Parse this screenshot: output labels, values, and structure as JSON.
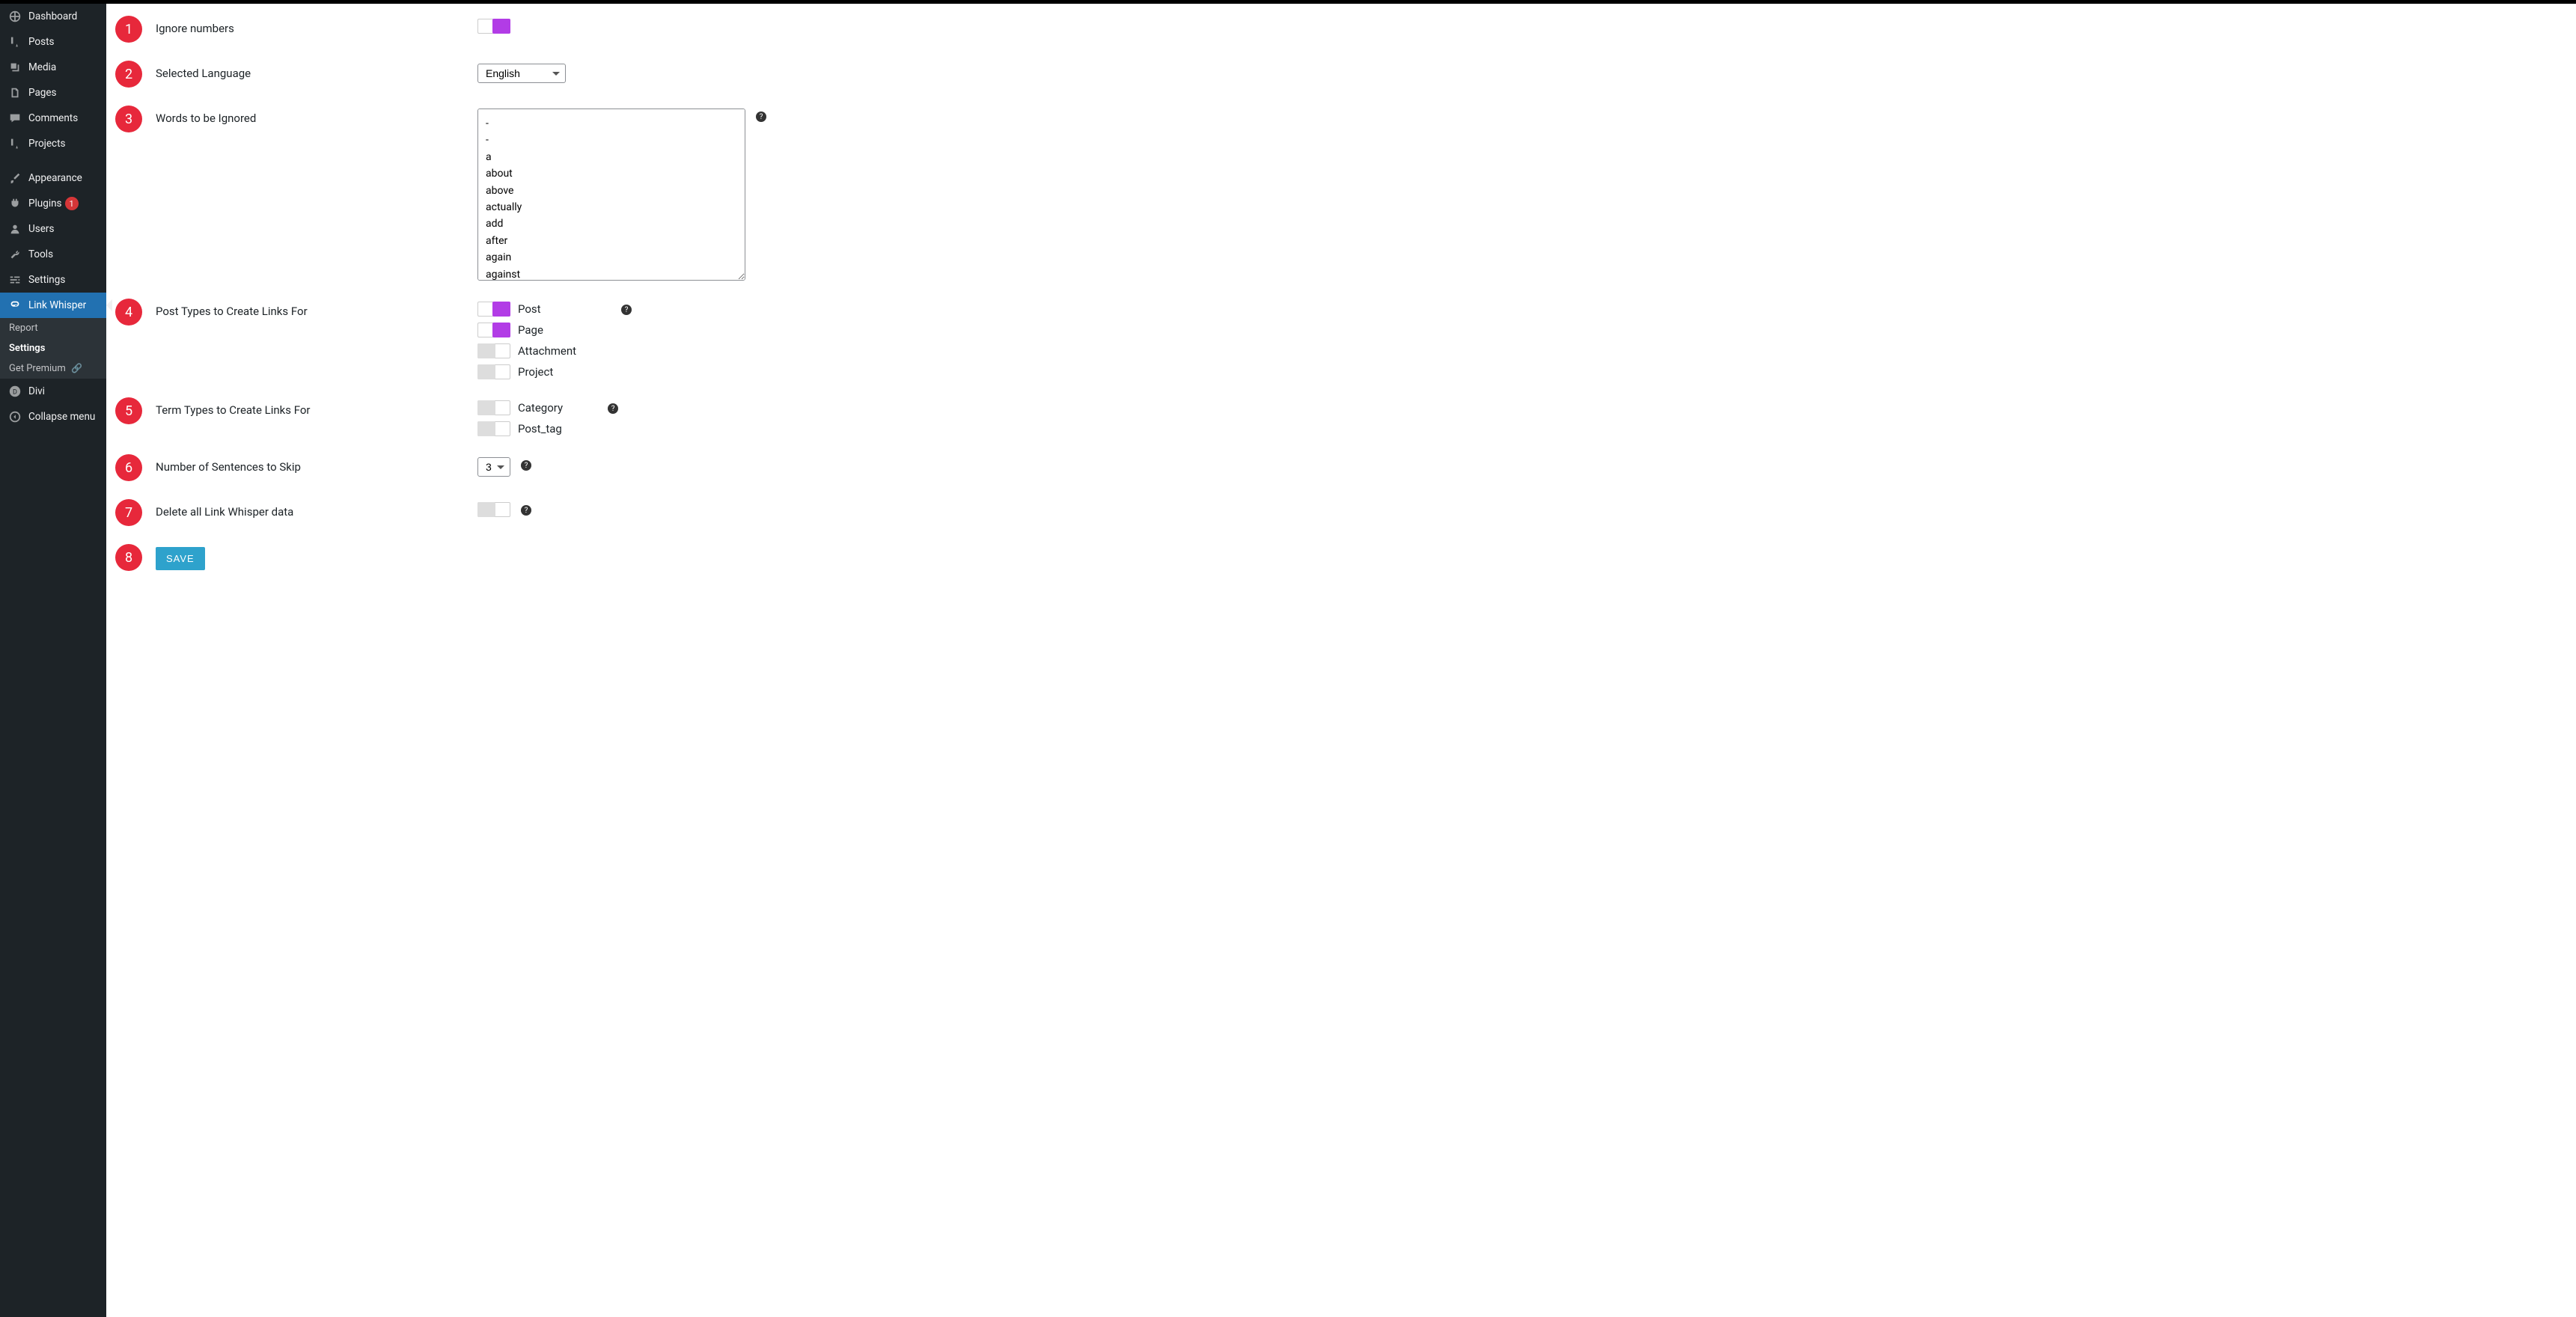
{
  "sidebar": {
    "items": [
      {
        "label": "Dashboard"
      },
      {
        "label": "Posts"
      },
      {
        "label": "Media"
      },
      {
        "label": "Pages"
      },
      {
        "label": "Comments"
      },
      {
        "label": "Projects"
      },
      {
        "label": "Appearance"
      },
      {
        "label": "Plugins",
        "badge": "1"
      },
      {
        "label": "Users"
      },
      {
        "label": "Tools"
      },
      {
        "label": "Settings"
      },
      {
        "label": "Link Whisper"
      },
      {
        "label": "Divi"
      },
      {
        "label": "Collapse menu"
      }
    ],
    "submenu": {
      "report": "Report",
      "settings": "Settings",
      "premium": "Get Premium"
    }
  },
  "annotations": [
    "1",
    "2",
    "3",
    "4",
    "5",
    "6",
    "7",
    "8"
  ],
  "settings": {
    "ignore_numbers": {
      "label": "Ignore numbers",
      "on": true
    },
    "language": {
      "label": "Selected Language",
      "value": "English"
    },
    "ignored_words": {
      "label": "Words to be Ignored",
      "value": "-\n-\na\nabout\nabove\nactually\nadd\nafter\nagain\nagainst"
    },
    "post_types": {
      "label": "Post Types to Create Links For",
      "items": [
        {
          "label": "Post",
          "on": true
        },
        {
          "label": "Page",
          "on": true
        },
        {
          "label": "Attachment",
          "on": false
        },
        {
          "label": "Project",
          "on": false
        }
      ]
    },
    "term_types": {
      "label": "Term Types to Create Links For",
      "items": [
        {
          "label": "Category",
          "on": false
        },
        {
          "label": "Post_tag",
          "on": false
        }
      ]
    },
    "skip_sentences": {
      "label": "Number of Sentences to Skip",
      "value": "3"
    },
    "delete_data": {
      "label": "Delete all Link Whisper data",
      "on": false
    },
    "save_button": "SAVE"
  }
}
